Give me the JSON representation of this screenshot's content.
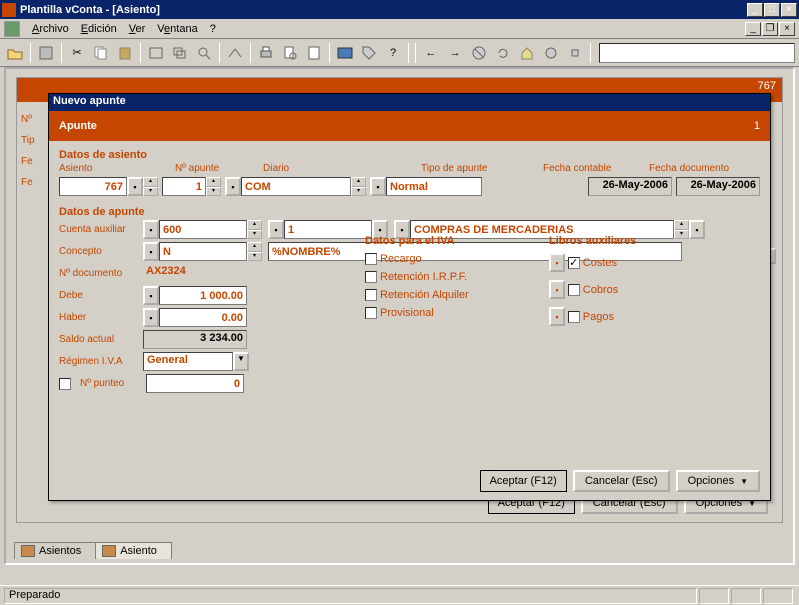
{
  "window": {
    "title": "Plantilla vConta - [Asiento]"
  },
  "menu": {
    "archivo": "Archivo",
    "edicion": "Edición",
    "ver": "Ver",
    "ventana": "Ventana",
    "ayuda": "?"
  },
  "bg": {
    "num": "767",
    "labels": {
      "no": "Nº",
      "tip": "Tip",
      "fe1": "Fe",
      "fe2": "Fe"
    }
  },
  "dialog": {
    "title": "Nuevo apunte",
    "header": "Apunte",
    "header_num": "1",
    "sec_asiento": "Datos de asiento",
    "sec_apunte": "Datos de apunte",
    "labels": {
      "asiento": "Asiento",
      "n_apunte": "Nº apunte",
      "diario": "Diario",
      "tipo_apunte": "Tipo de apunte",
      "fecha_contable": "Fecha contable",
      "fecha_doc": "Fecha documento",
      "cuenta_aux": "Cuenta auxiliar",
      "concepto": "Concepto",
      "n_doc": "Nº documento",
      "debe": "Debe",
      "haber": "Haber",
      "saldo": "Saldo actual",
      "regimen": "Régimen I.V.A",
      "n_punteo": "Nº punteo"
    },
    "values": {
      "asiento": "767",
      "n_apunte": "1",
      "diario": "COM",
      "tipo_apunte": "Normal",
      "fecha_contable": "26-May-2006",
      "fecha_doc": "26-May-2006",
      "cuenta1": "600",
      "cuenta2": "1",
      "cuenta_desc": "COMPRAS DE MERCADERIAS",
      "concepto1": "N",
      "concepto2": "%NOMBRE%",
      "n_doc": "AX2324",
      "debe": "1 000.00",
      "haber": "0.00",
      "saldo": "3 234.00",
      "regimen": "General",
      "n_punteo": "0"
    },
    "iva": {
      "title": "Datos para el IVA",
      "recargo": "Recargo",
      "ret_irpf": "Retención I.R.P.F.",
      "ret_alq": "Retención Alquiler",
      "provisional": "Provisional"
    },
    "libros": {
      "title": "Libros auxiliares",
      "costes": "Costes",
      "cobros": "Cobros",
      "pagos": "Pagos",
      "costes_checked": true
    },
    "buttons": {
      "aceptar": "Aceptar (F12)",
      "cancelar": "Cancelar (Esc)",
      "opciones": "Opciones"
    }
  },
  "tabs": {
    "asientos": "Asientos",
    "asiento": "Asiento"
  },
  "status": "Preparado"
}
